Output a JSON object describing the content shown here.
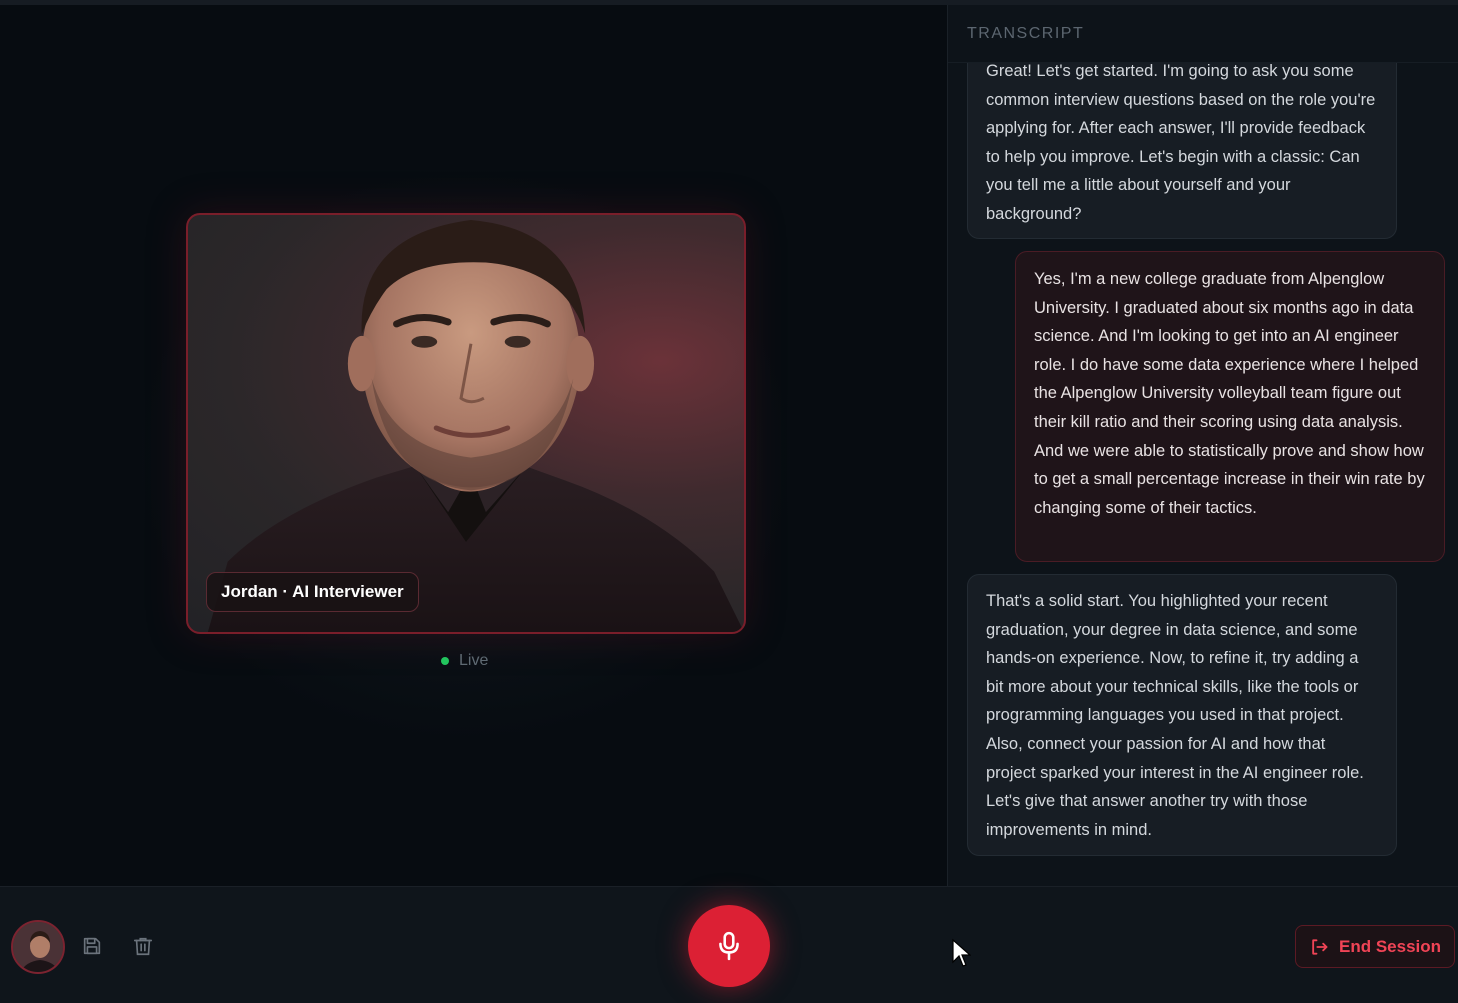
{
  "video": {
    "name_tag": "Jordan · AI Interviewer",
    "status": "Live",
    "status_color": "#22c55e",
    "accent": "#7a1e2a"
  },
  "transcript": {
    "title": "TRANSCRIPT",
    "messages": [
      {
        "role": "ai",
        "text": "Great! Let's get started. I'm going to ask you some common interview questions based on the role you're applying for. After each answer, I'll provide feedback to help you improve. Let's begin with a classic: Can you tell me a little about yourself and your background?"
      },
      {
        "role": "user",
        "text": "Yes, I'm a new college graduate from Alpenglow University. I graduated about six months ago in data science. And I'm looking to get into an AI engineer role. I do have some data experience where I helped the Alpenglow University volleyball team figure out their kill ratio and their scoring using data analysis. And we were able to statistically prove and show how to get a small percentage increase in their win rate by changing some of their tactics."
      },
      {
        "role": "ai",
        "text": "That's a solid start. You highlighted your recent graduation, your degree in data science, and some hands-on experience. Now, to refine it, try adding a bit more about your technical skills, like the tools or programming languages you used in that project. Also, connect your passion for AI and how that project sparked your interest in the AI engineer role. Let's give that answer another try with those improvements in mind."
      }
    ]
  },
  "controls": {
    "avatar_icon": "avatar",
    "save_icon": "save-icon",
    "delete_icon": "trash-icon",
    "mic_icon": "microphone-icon",
    "mic_color": "#dc2034",
    "end_session_label": "End Session",
    "end_session_icon": "logout-icon"
  }
}
